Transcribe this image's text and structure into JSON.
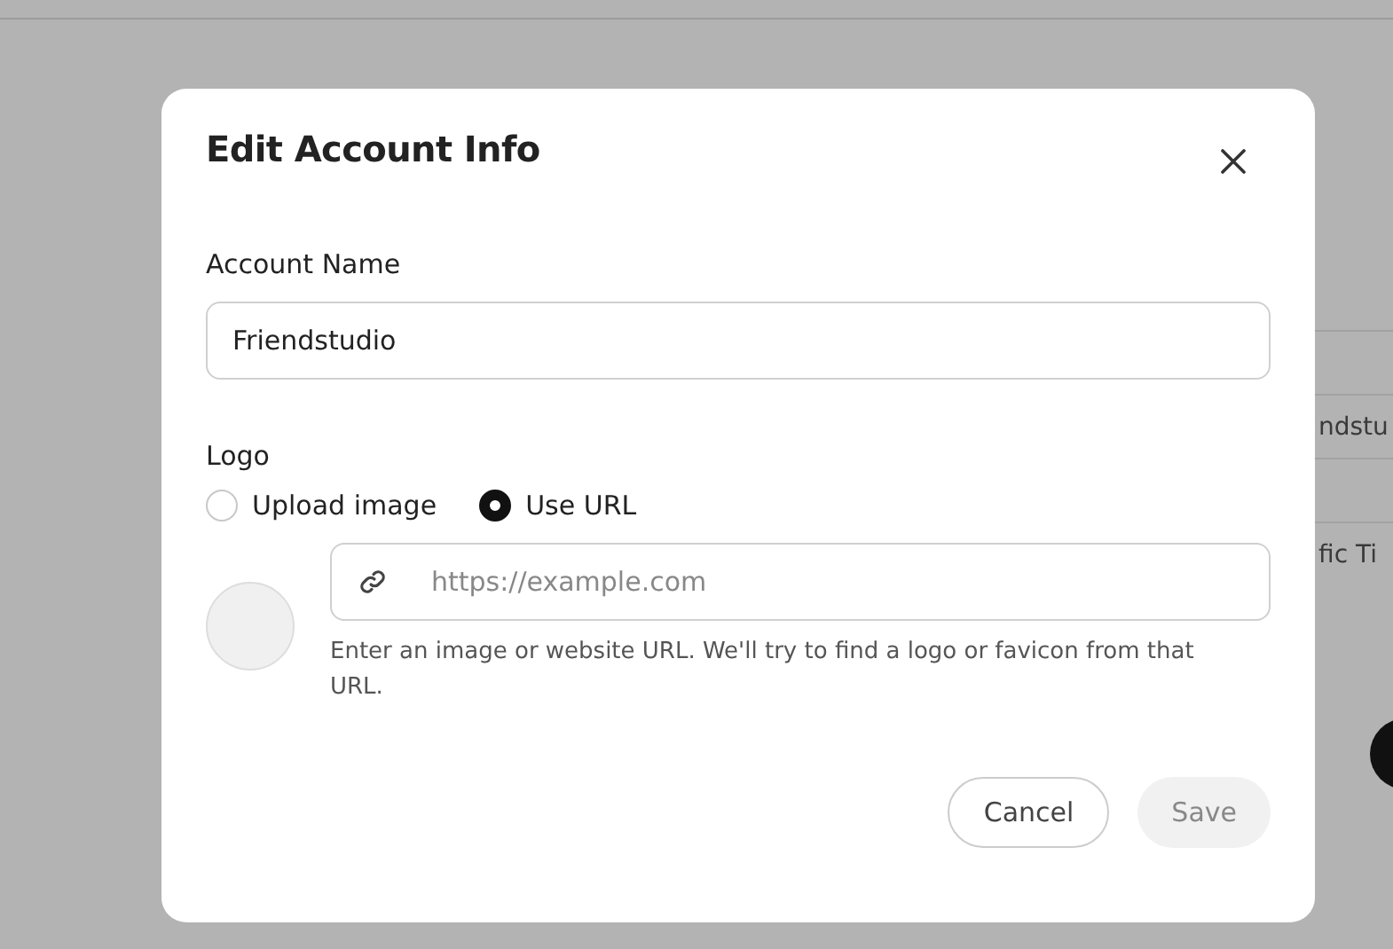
{
  "background": {
    "field_1": "ndstu",
    "field_2": "fic Ti"
  },
  "dialog": {
    "title": "Edit Account Info",
    "account_name": {
      "label": "Account Name",
      "value": "Friendstudio"
    },
    "logo": {
      "label": "Logo",
      "options": [
        {
          "label": "Upload image",
          "selected": false
        },
        {
          "label": "Use URL",
          "selected": true
        }
      ],
      "url_field": {
        "placeholder": "https://example.com"
      },
      "help": "Enter an image or website URL. We'll try to find a logo or favicon from that URL."
    },
    "buttons": [
      {
        "label": "Cancel",
        "kind": "secondary",
        "disabled": false
      },
      {
        "label": "Save",
        "kind": "primary",
        "disabled": true
      }
    ]
  }
}
